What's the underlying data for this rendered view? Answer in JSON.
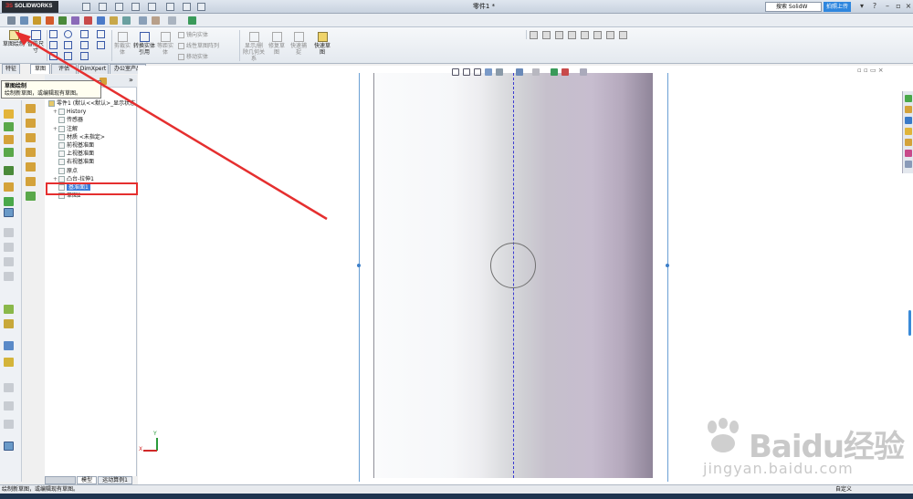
{
  "app": {
    "logo": "SOLIDWORKS",
    "document_title": "零件1 *",
    "search_placeholder": "搜索 SolidW",
    "upload_label": "拍照上传"
  },
  "ribbon": {
    "sketch_button": "草图绘制",
    "smart_dim_button": "智能尺寸",
    "trim_entities": "剪裁实体",
    "convert_entities": "转换实体引用",
    "offset_entities": "等距实体",
    "mirror_entities": "镜向实体",
    "linear_pattern": "线性草图阵列",
    "move_entities": "移动实体",
    "display_relations": "显示/删除几何关系",
    "repair_sketch": "修复草图",
    "quick_snaps": "快速捕捉",
    "rapid_sketch": "快速草图"
  },
  "command_tabs": [
    "特征",
    "草图",
    "评估",
    "DimXpert",
    "办公室产品"
  ],
  "tooltip": {
    "title": "草图绘制",
    "body": "绘制新草图，或编辑现有草图。"
  },
  "tree": {
    "root": "零件1 (默认<<默认>_显示状态",
    "items": [
      {
        "label": "History",
        "indent": 1,
        "expand": "+"
      },
      {
        "label": "传感器",
        "indent": 1,
        "expand": ""
      },
      {
        "label": "注解",
        "indent": 1,
        "expand": "+"
      },
      {
        "label": "材质 <未指定>",
        "indent": 1,
        "expand": ""
      },
      {
        "label": "前视基准面",
        "indent": 1,
        "expand": ""
      },
      {
        "label": "上视基准面",
        "indent": 1,
        "expand": ""
      },
      {
        "label": "右视基准面",
        "indent": 1,
        "expand": ""
      },
      {
        "label": "原点",
        "indent": 1,
        "expand": ""
      },
      {
        "label": "凸台-拉伸1",
        "indent": 1,
        "expand": "+"
      },
      {
        "label": "基准面1",
        "indent": 1,
        "expand": "",
        "selected": true
      },
      {
        "label": "草图2",
        "indent": 1,
        "expand": ""
      }
    ]
  },
  "bottom_tabs": [
    "模型",
    "运动算例1"
  ],
  "status": {
    "message": "绘制新草图，或编辑现有草图。",
    "mode": "自定义"
  },
  "watermark": {
    "main": "Baidu经验",
    "url": "jingyan.baidu.com"
  },
  "triad": {
    "x": "X",
    "y": "Y"
  },
  "colors": {
    "annotation_red": "#e52f2f",
    "selection_blue": "#3b7bd8",
    "centerline_blue": "#3a3ad0"
  }
}
